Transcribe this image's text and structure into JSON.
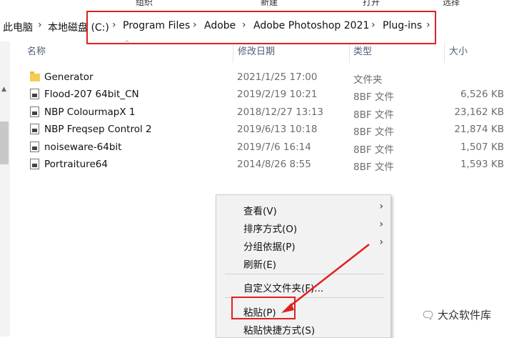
{
  "ribbon": {
    "labels": [
      "组织",
      "新建",
      "打开",
      "选择"
    ]
  },
  "breadcrumb": {
    "items": [
      "此电脑",
      "本地磁盘 (C:)",
      "Program Files",
      "Adobe",
      "Adobe Photoshop 2021",
      "Plug-ins"
    ],
    "separator": "›"
  },
  "columns": {
    "name": "名称",
    "date": "修改日期",
    "type": "类型",
    "size": "大小"
  },
  "files": [
    {
      "name": "Generator",
      "date": "2021/1/25 17:00",
      "type": "文件夹",
      "size": "",
      "icon": "folder-icon"
    },
    {
      "name": "Flood-207 64bit_CN",
      "date": "2019/2/19 10:21",
      "type": "8BF 文件",
      "size": "6,526 KB",
      "icon": "plugin-file-icon"
    },
    {
      "name": "NBP ColourmapX 1",
      "date": "2018/12/27 13:13",
      "type": "8BF 文件",
      "size": "23,162 KB",
      "icon": "plugin-file-icon"
    },
    {
      "name": "NBP Freqsep Control 2",
      "date": "2019/6/13 10:18",
      "type": "8BF 文件",
      "size": "21,874 KB",
      "icon": "plugin-file-icon"
    },
    {
      "name": "noiseware-64bit",
      "date": "2019/7/6 16:14",
      "type": "8BF 文件",
      "size": "1,507 KB",
      "icon": "plugin-file-icon"
    },
    {
      "name": "Portraiture64",
      "date": "2014/8/26 8:55",
      "type": "8BF 文件",
      "size": "1,593 KB",
      "icon": "plugin-file-icon"
    }
  ],
  "context_menu": {
    "view": "查看(V)",
    "sort": "排序方式(O)",
    "group": "分组依据(P)",
    "refresh": "刷新(E)",
    "customize": "自定义文件夹(F)...",
    "paste": "粘贴(P)",
    "paste_shortcut": "粘贴快捷方式(S)",
    "submenu_arrow": "›"
  },
  "watermark": {
    "text": "大众软件库",
    "icon": "wechat-icon"
  },
  "colors": {
    "highlight": "#e02020",
    "header_text": "#4c607a",
    "folder": "#f6cc54"
  }
}
